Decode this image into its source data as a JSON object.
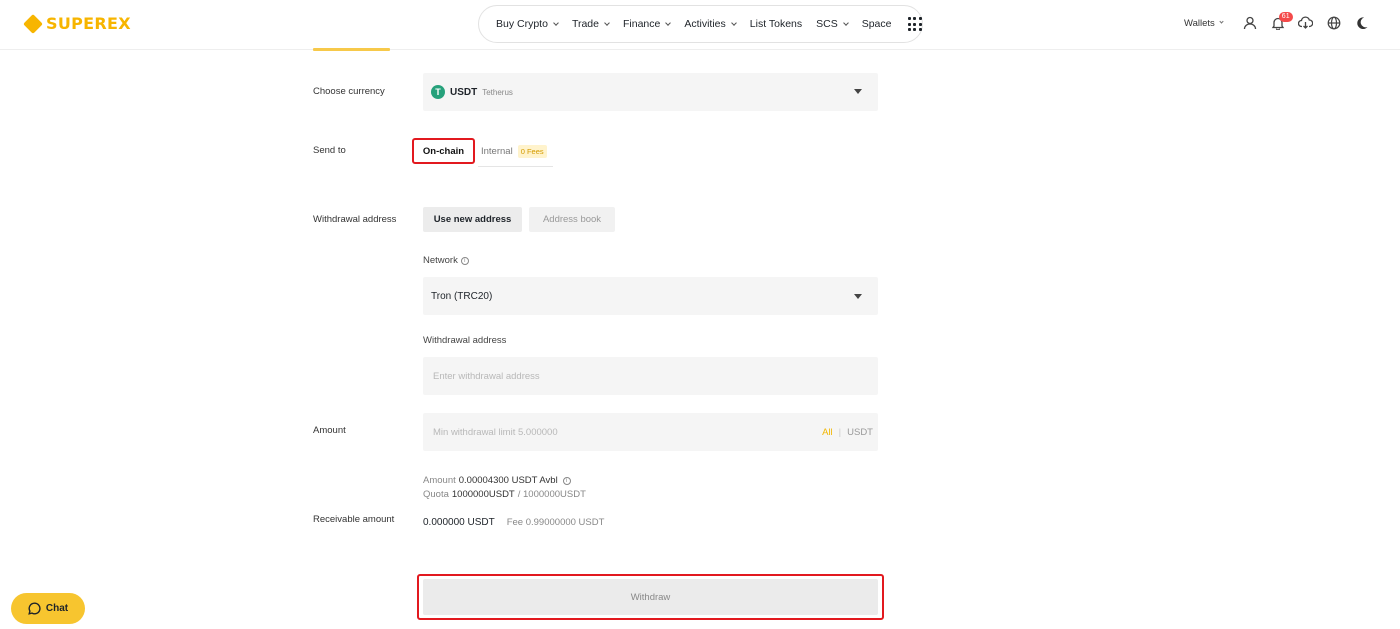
{
  "brand": {
    "name": "SUPEREX",
    "color": "#f7b500"
  },
  "nav": {
    "items": [
      {
        "label": "Buy Crypto",
        "dropdown": true
      },
      {
        "label": "Trade",
        "dropdown": true
      },
      {
        "label": "Finance",
        "dropdown": true
      },
      {
        "label": "Activities",
        "dropdown": true
      },
      {
        "label": "List Tokens",
        "dropdown": false
      },
      {
        "label": "SCS",
        "dropdown": true
      },
      {
        "label": "Space",
        "dropdown": false
      }
    ],
    "apps_icon": "grid-icon"
  },
  "header_right": {
    "wallets_label": "Wallets",
    "notification_count": "61",
    "icons": [
      "user-icon",
      "bell-icon",
      "download-icon",
      "globe-icon",
      "moon-icon"
    ]
  },
  "form": {
    "currency": {
      "label": "Choose currency",
      "code": "USDT",
      "name": "Tetherus",
      "icon_letter": "T"
    },
    "send_to": {
      "label": "Send to",
      "onchain_label": "On-chain",
      "internal_label": "Internal",
      "internal_fee_badge": "0 Fees"
    },
    "withdrawal": {
      "label": "Withdrawal address",
      "use_new_label": "Use new address",
      "address_book_label": "Address book",
      "network_label": "Network",
      "network_value": "Tron (TRC20)",
      "address_label": "Withdrawal address",
      "address_placeholder": "Enter withdrawal address"
    },
    "amount": {
      "label": "Amount",
      "placeholder": "Min withdrawal limit 5.000000",
      "all_label": "All",
      "separator": "|",
      "unit": "USDT",
      "avbl_prefix": "Amount",
      "avbl_value": "0.00004300 USDT Avbl",
      "quota_prefix": "Quota",
      "quota_value": "1000000USDT",
      "quota_total": "/ 1000000USDT"
    },
    "receivable": {
      "label": "Receivable amount",
      "value": "0.000000 USDT",
      "fee": "Fee 0.99000000 USDT"
    },
    "withdraw_button": "Withdraw"
  },
  "chat": {
    "label": "Chat"
  },
  "colors": {
    "highlight": "#e2191f",
    "accent": "#f7c52f",
    "usdt": "#26a17b"
  }
}
